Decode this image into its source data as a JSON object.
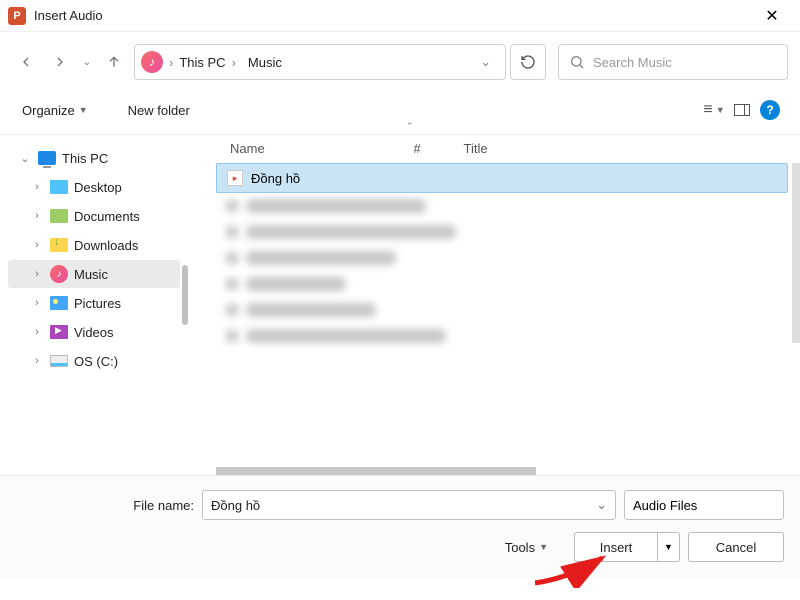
{
  "title_bar": {
    "title": "Insert Audio"
  },
  "breadcrumb": {
    "seg1": "This PC",
    "seg2": "Music"
  },
  "search": {
    "placeholder": "Search Music"
  },
  "toolbar": {
    "organize": "Organize",
    "new_folder": "New folder"
  },
  "sidebar": {
    "this_pc": "This PC",
    "desktop": "Desktop",
    "documents": "Documents",
    "downloads": "Downloads",
    "music": "Music",
    "pictures": "Pictures",
    "videos": "Videos",
    "os_c": "OS (C:)"
  },
  "columns": {
    "name": "Name",
    "hash": "#",
    "title": "Title"
  },
  "files": {
    "selected_name": "Đồng hồ"
  },
  "bottom": {
    "filename_label": "File name:",
    "filename_value": "Đồng hồ",
    "filetype": "Audio Files",
    "tools": "Tools",
    "insert": "Insert",
    "cancel": "Cancel"
  }
}
